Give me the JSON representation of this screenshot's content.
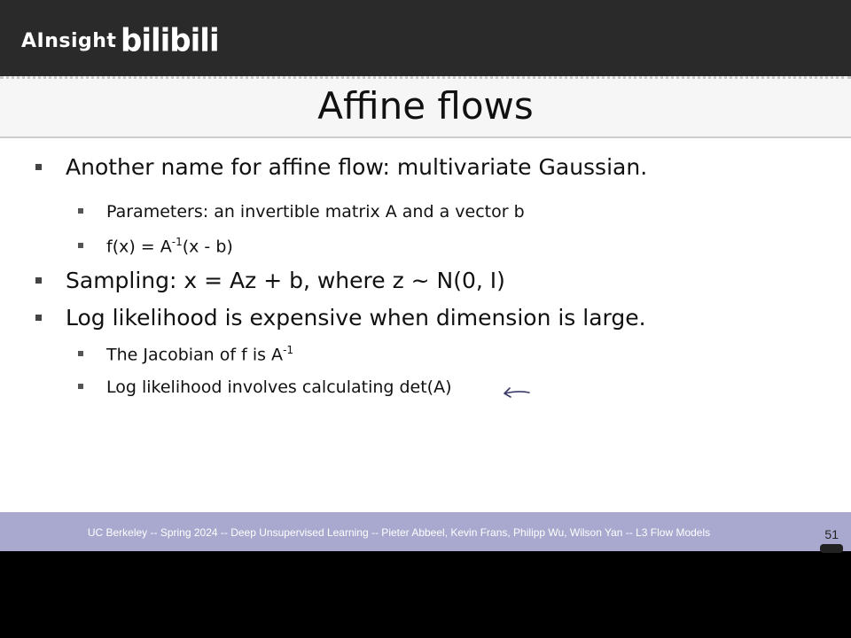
{
  "header": {
    "brand_text": "AInsight",
    "logo_text": "bilibili"
  },
  "slide": {
    "title": "Affine flows",
    "bullets": [
      {
        "text": "Another name for affine flow: multivariate Gaussian."
      },
      {
        "sub": [
          {
            "text": "Parameters: an invertible matrix A and a vector b"
          },
          {
            "pre": "f(x) = A",
            "sup": "-1",
            "post": "(x - b)"
          }
        ]
      },
      {
        "text": "Sampling: x = Az + b, where z ~ N(0, I)"
      },
      {
        "text": "Log likelihood is expensive when dimension is large."
      },
      {
        "sub": [
          {
            "pre": "The Jacobian of f is A",
            "sup": "-1",
            "post": ""
          },
          {
            "text": "Log likelihood involves calculating det(A)"
          }
        ]
      }
    ]
  },
  "footer": {
    "text": "UC Berkeley -- Spring 2024 -- Deep Unsupervised Learning -- Pieter Abbeel, Kevin Frans, Philipp Wu, Wilson Yan -- L3 Flow Models",
    "page_number": "51"
  },
  "colors": {
    "footer_bg": "#a9a9cf",
    "topbar_bg": "#2a2a2a"
  }
}
